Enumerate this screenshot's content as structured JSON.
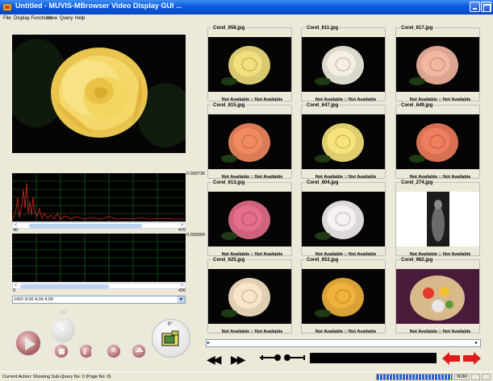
{
  "window": {
    "title": "Untitled  - MUVIS-MBrowser Video Display GUI ..."
  },
  "menu": {
    "items": [
      "File",
      "Display Functions",
      "View",
      "Query",
      "Help"
    ]
  },
  "histogram": {
    "top_value": "0.000736",
    "bottom_value": "0.000000",
    "scroll1_min": "40",
    "scroll1_max": "476",
    "scroll2_min": "0",
    "scroll2_max": "436"
  },
  "feature_select": {
    "value": "HSV  8.00   4.00   4.00"
  },
  "controls": {
    "speaker_deg": "99°",
    "camera_deg": "0°"
  },
  "thumbnails": [
    {
      "filename": "Corel_658.jpg",
      "score": "Not Available :: Not Available",
      "color": "#f0df7c"
    },
    {
      "filename": "Corel_611.jpg",
      "score": "Not Available :: Not Available",
      "color": "#f4efe2"
    },
    {
      "filename": "Corel_617.jpg",
      "score": "Not Available :: Not Available",
      "color": "#f3b7a0"
    },
    {
      "filename": "Corel_615.jpg",
      "score": "Not Available :: Not Available",
      "color": "#f28a60"
    },
    {
      "filename": "Corel_647.jpg",
      "score": "Not Available :: Not Available",
      "color": "#f6e47a"
    },
    {
      "filename": "Corel_649.jpg",
      "score": "Not Available :: Not Available",
      "color": "#f07d5d"
    },
    {
      "filename": "Corel_613.jpg",
      "score": "Not Available :: Not Available",
      "color": "#e46e8c"
    },
    {
      "filename": "Corel_604.jpg",
      "score": "Not Available :: Not Available",
      "color": "#f5f0f2"
    },
    {
      "filename": "Corel_274.jpg",
      "score": "Not Available :: Not Available",
      "color": "#6b6b6b"
    },
    {
      "filename": "Corel_625.jpg",
      "score": "Not Available :: Not Available",
      "color": "#f7e5c8"
    },
    {
      "filename": "Corel_653.jpg",
      "score": "Not Available :: Not Available",
      "color": "#f1b23c"
    },
    {
      "filename": "Corel_982.jpg",
      "score": "Not Available :: Not Available",
      "color": "#d9b98a"
    }
  ],
  "status": {
    "text": "Current Action: Showing Sub-Query No: 0  (Page No: 0)",
    "num": "NUM"
  }
}
